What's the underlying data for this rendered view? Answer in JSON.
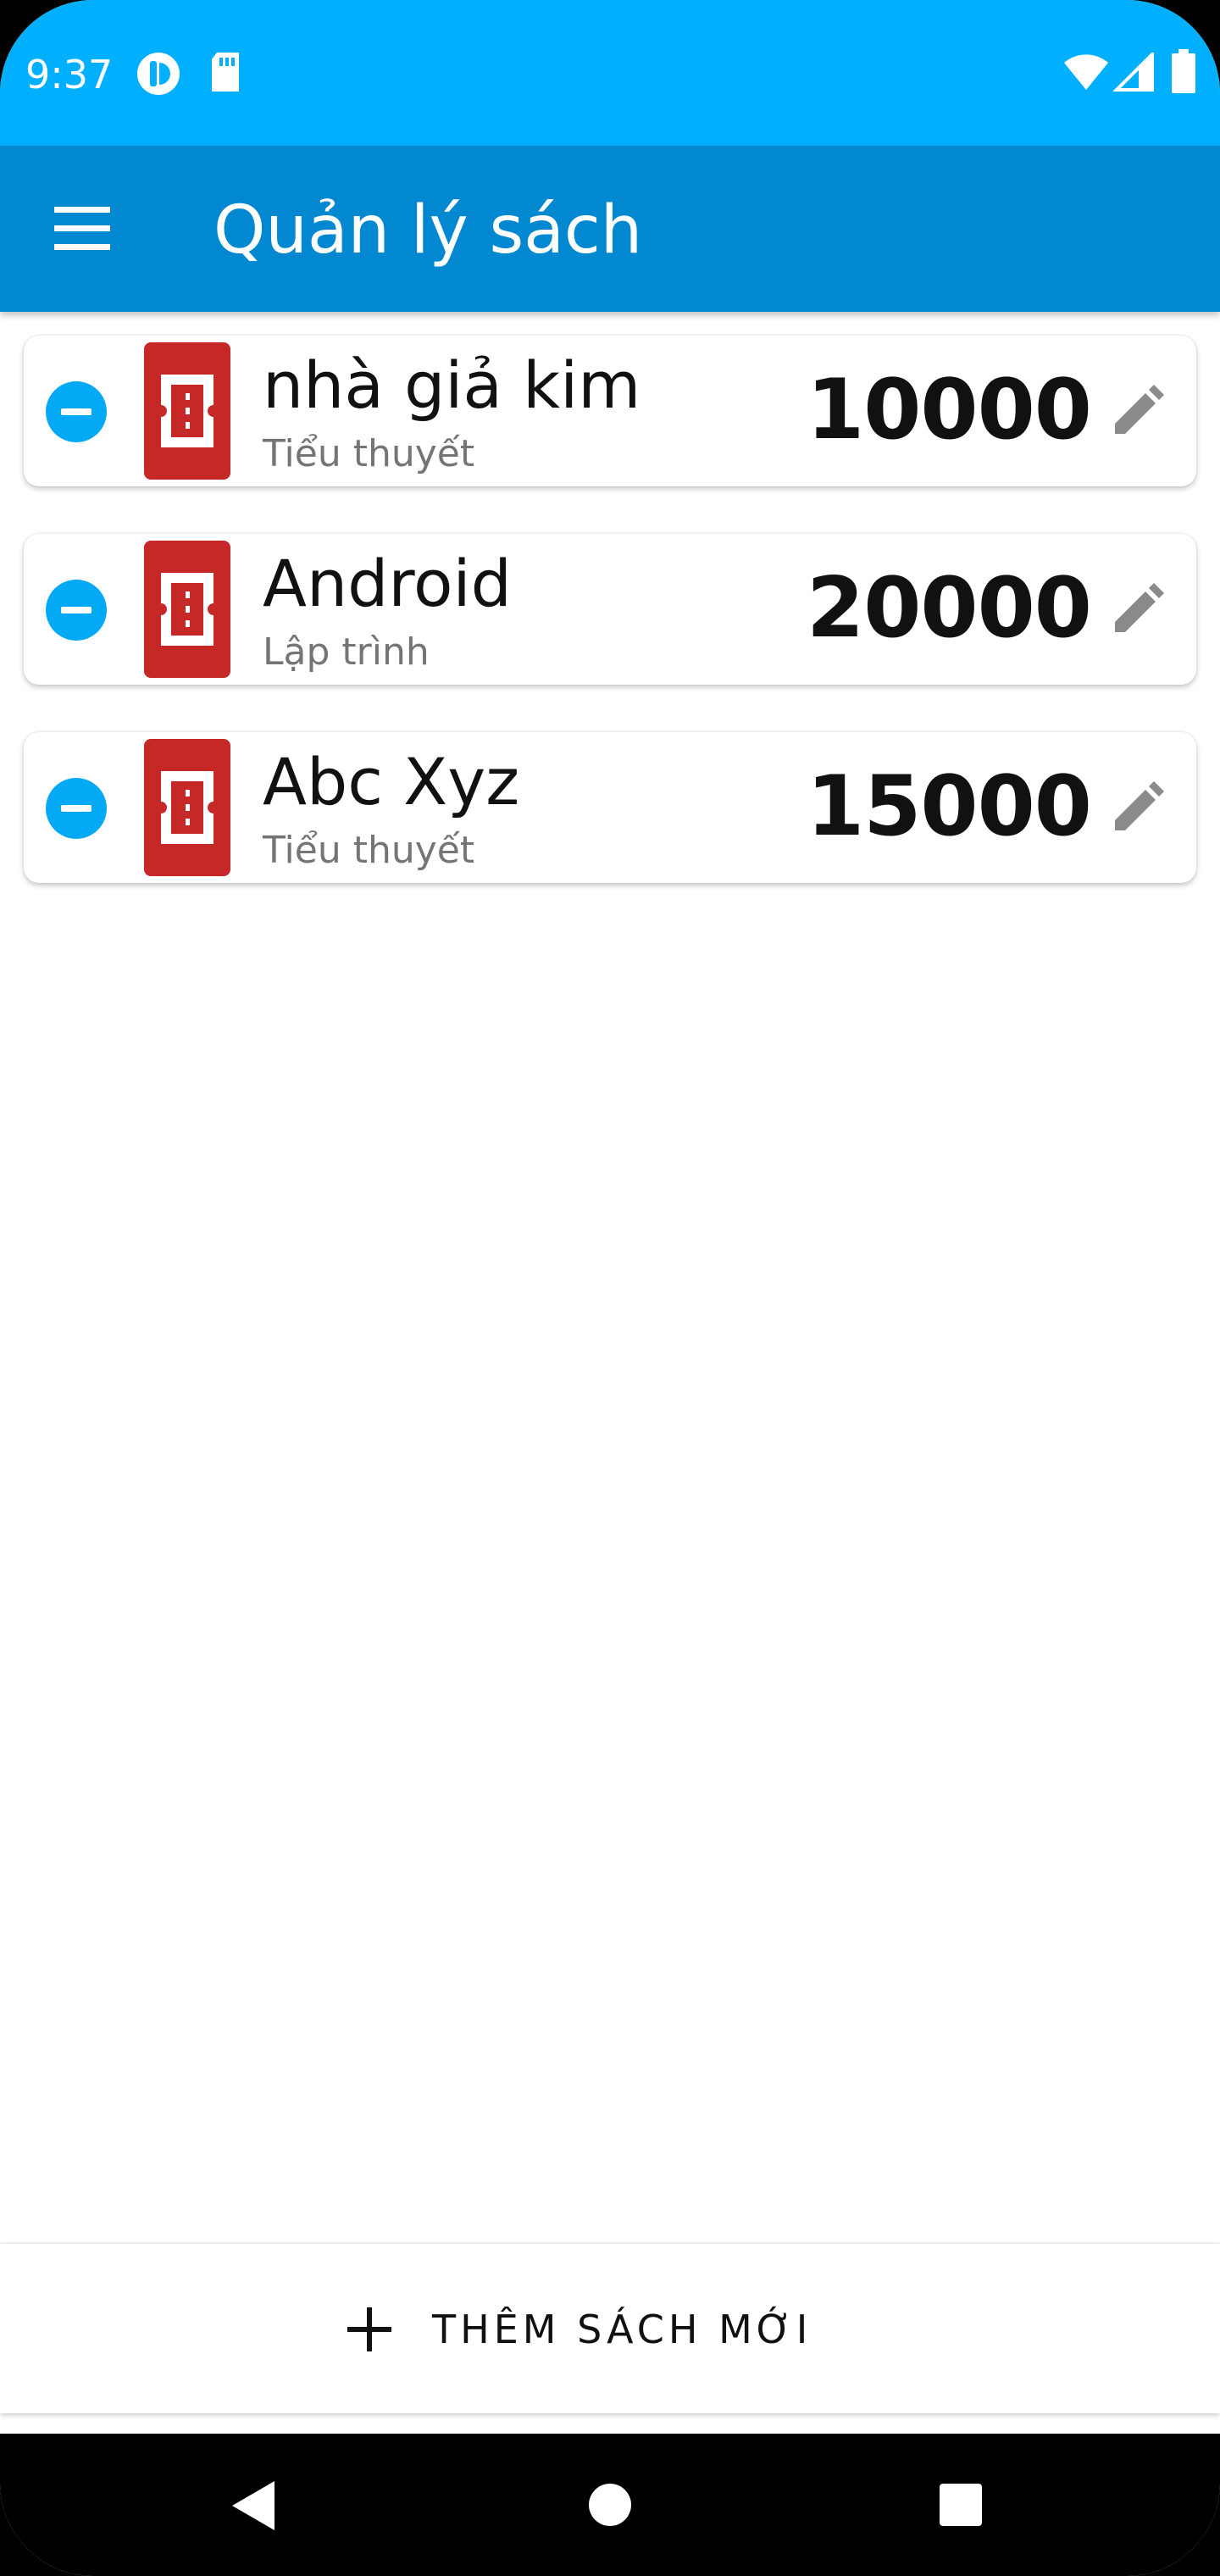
{
  "status_bar": {
    "time": "9:37",
    "background": "#00b0ff",
    "icons": [
      "pocket-casts-icon",
      "sd-card-icon",
      "wifi-icon",
      "cell-signal-icon",
      "battery-icon"
    ]
  },
  "app_bar": {
    "title": "Quản lý sách",
    "background": "#0288d1",
    "menu_icon": "hamburger-menu-icon"
  },
  "books": [
    {
      "name": "nhà giả kim",
      "category": "Tiểu thuyết",
      "price": "10000"
    },
    {
      "name": "Android",
      "category": "Lập trình",
      "price": "20000"
    },
    {
      "name": "Abc Xyz",
      "category": "Tiểu thuyết",
      "price": "15000"
    }
  ],
  "row_icons": {
    "remove": "remove-circle-icon",
    "book": "book-icon",
    "edit": "pencil-edit-icon"
  },
  "colors": {
    "remove_button": "#03a9f4",
    "book_icon": "#c62828",
    "edit_icon": "#8a8a8a"
  },
  "add_button": {
    "label": "THÊM SÁCH MỚI",
    "icon": "plus-icon"
  },
  "nav_bar": {
    "icons": [
      "back-triangle-icon",
      "home-circle-icon",
      "recents-square-icon"
    ]
  }
}
